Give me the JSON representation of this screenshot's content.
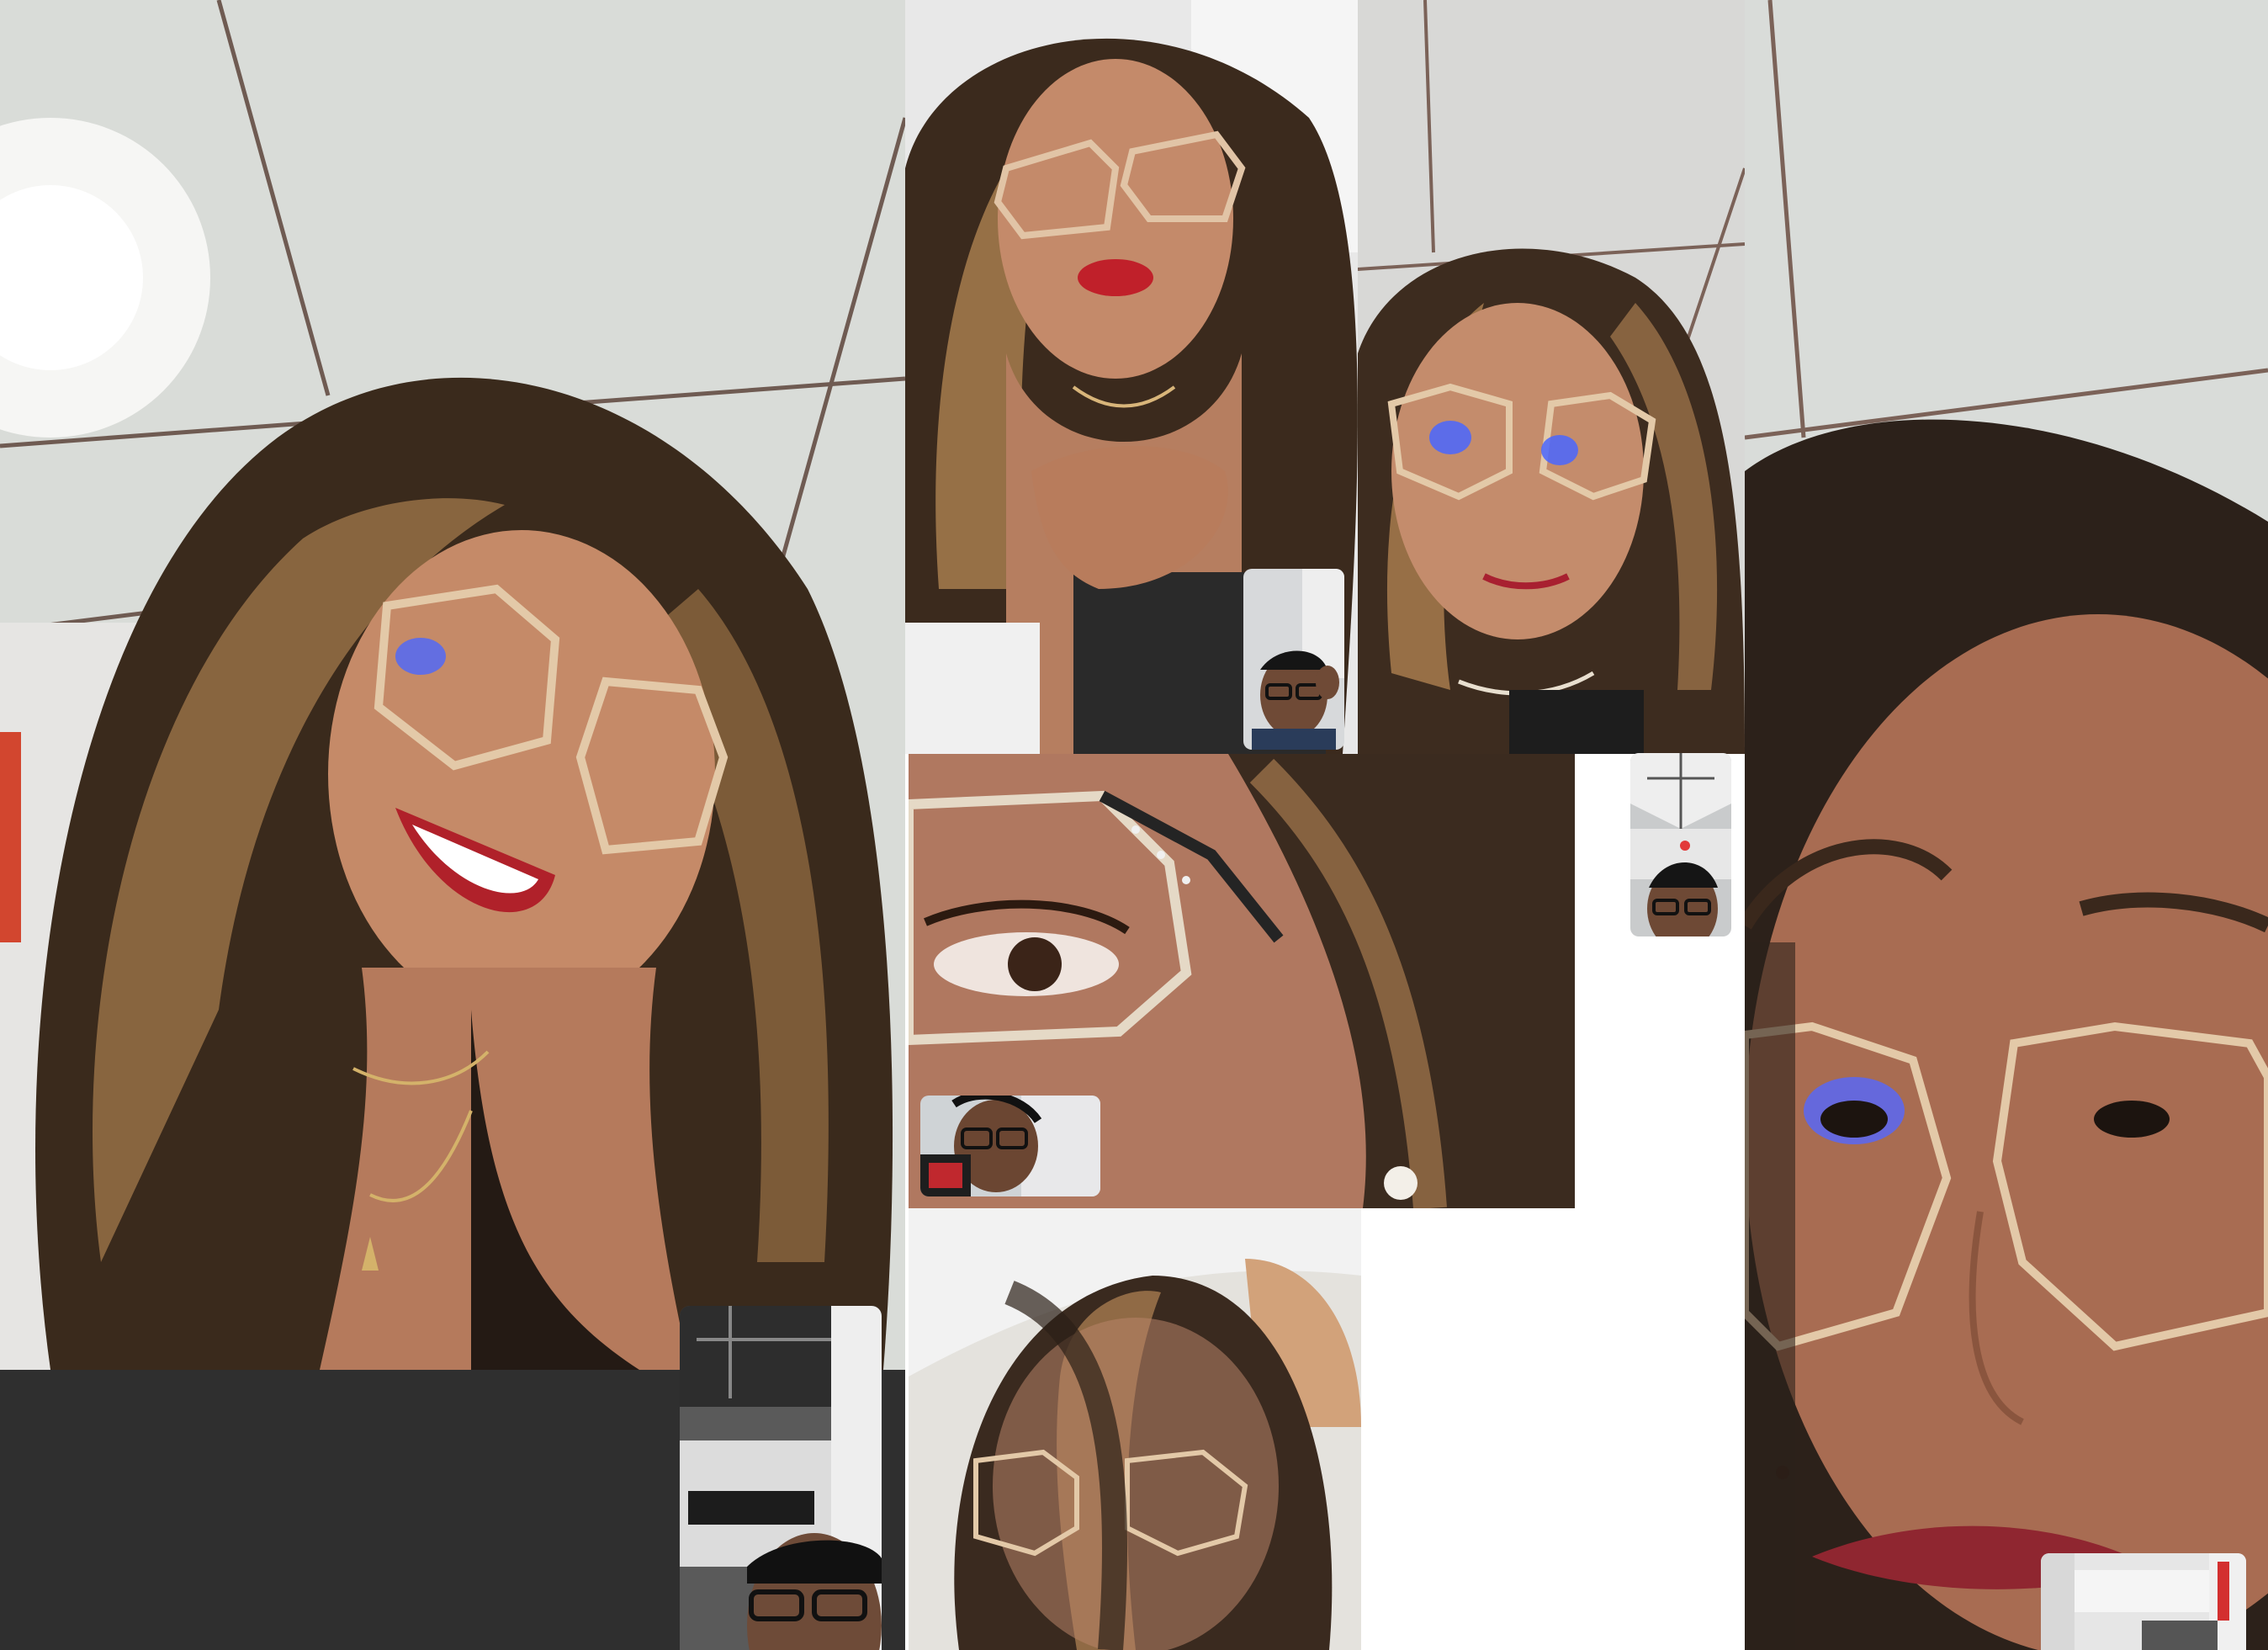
{
  "screen": {
    "description_tiles": [
      "video-call-screenshot-1",
      "video-call-screenshot-2",
      "video-call-screenshot-3",
      "video-call-screenshot-4",
      "video-call-screenshot-5",
      "video-call-screenshot-6"
    ]
  },
  "colors": {
    "ceiling": "#d9dcd8",
    "ceiling_shadow": "#b9bdb8",
    "hair_dark": "#3a2a1c",
    "hair_highlight": "#9c7448",
    "skin": "#b57a5c",
    "skin_light": "#c99072",
    "lips": "#b0212a",
    "blank_area": "#2f2f2f",
    "glasses_frame": "#e3c9a8",
    "lens_glint": "#4a66ff"
  }
}
